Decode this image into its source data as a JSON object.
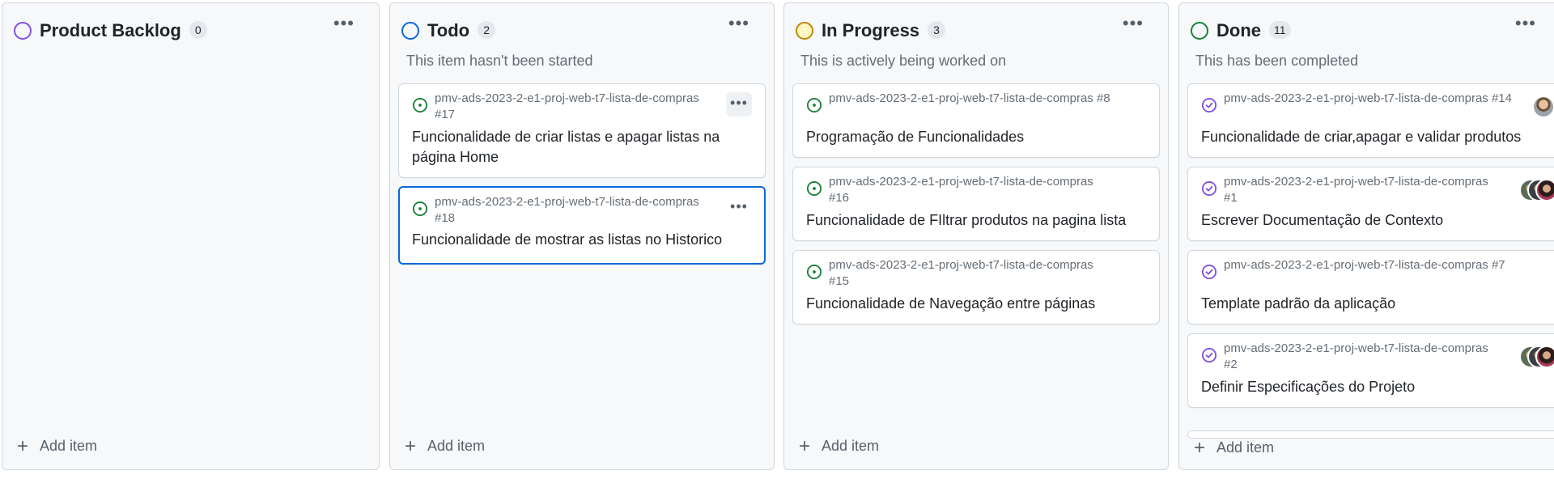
{
  "columns": [
    {
      "title": "Product Backlog",
      "count": "0",
      "description": "",
      "status_color": "#8250df",
      "add_label": "Add item",
      "cards": []
    },
    {
      "title": "Todo",
      "count": "2",
      "description": "This item hasn't been started",
      "status_color": "#0969da",
      "add_label": "Add item",
      "cards": [
        {
          "repo": "pmv-ads-2023-2-e1-proj-web-t7-lista-de-compras #17",
          "title": "Funcionalidade de criar listas e apagar listas na página Home",
          "icon": "issue-open-icon"
        },
        {
          "repo": "pmv-ads-2023-2-e1-proj-web-t7-lista-de-compras #18",
          "title": "Funcionalidade de mostrar as listas no Historico",
          "icon": "issue-open-icon"
        }
      ]
    },
    {
      "title": "In Progress",
      "count": "3",
      "description": "This is actively being worked on",
      "status_color": "#bf8700",
      "add_label": "Add item",
      "cards": [
        {
          "repo": "pmv-ads-2023-2-e1-proj-web-t7-lista-de-compras #8",
          "title": "Programação de Funcionalidades",
          "icon": "issue-open-icon"
        },
        {
          "repo": "pmv-ads-2023-2-e1-proj-web-t7-lista-de-compras #16",
          "title": "Funcionalidade de FIltrar produtos na pagina lista",
          "icon": "issue-open-icon"
        },
        {
          "repo": "pmv-ads-2023-2-e1-proj-web-t7-lista-de-compras #15",
          "title": "Funcionalidade de Navegação entre páginas",
          "icon": "issue-open-icon"
        }
      ]
    },
    {
      "title": "Done",
      "count": "11",
      "description": "This has been completed",
      "status_color": "#1a7f37",
      "add_label": "Add item",
      "cards": [
        {
          "repo": "pmv-ads-2023-2-e1-proj-web-t7-lista-de-compras #14",
          "title": "Funcionalidade de criar,apagar e validar produtos",
          "icon": "issue-closed-icon"
        },
        {
          "repo": "pmv-ads-2023-2-e1-proj-web-t7-lista-de-compras #1",
          "title": "Escrever Documentação de Contexto",
          "icon": "issue-closed-icon"
        },
        {
          "repo": "pmv-ads-2023-2-e1-proj-web-t7-lista-de-compras #7",
          "title": "Template padrão da aplicação",
          "icon": "issue-closed-icon"
        },
        {
          "repo": "pmv-ads-2023-2-e1-proj-web-t7-lista-de-compras #2",
          "title": "Definir Especificações do Projeto",
          "icon": "issue-closed-icon"
        }
      ]
    }
  ],
  "colors": {
    "open_issue": "#1a7f37",
    "closed_issue": "#8250df",
    "selected_border": "#0969da"
  }
}
